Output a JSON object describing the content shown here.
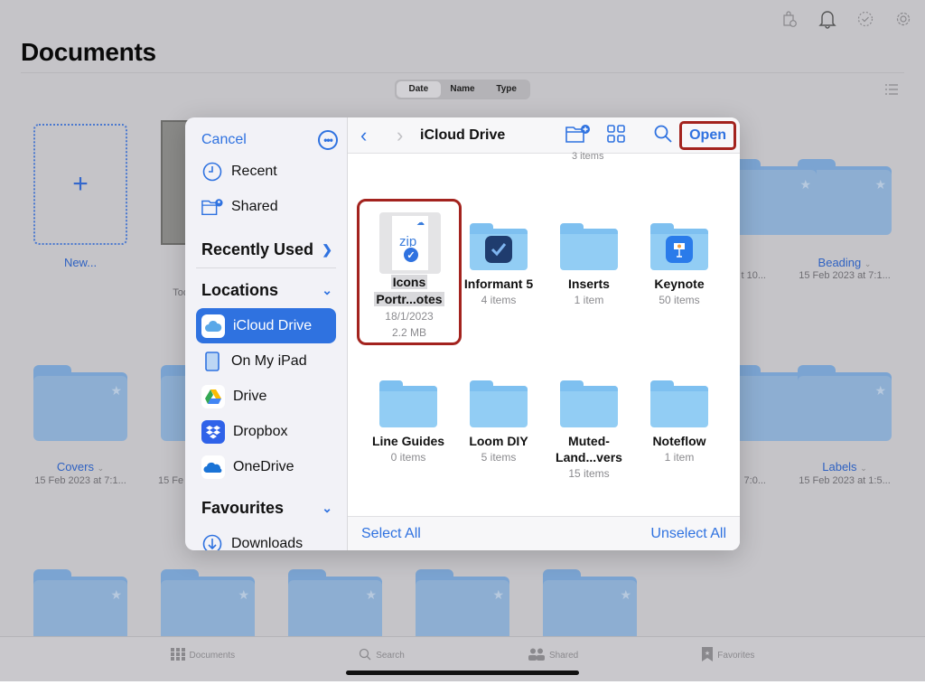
{
  "background_app": {
    "title": "Documents",
    "top_icons": [
      "shopping-bag-clock-icon",
      "bell-icon",
      "checkmark-circle-icon",
      "gear-icon"
    ],
    "sort_options": [
      {
        "label": "Date",
        "active": true
      },
      {
        "label": "Name",
        "active": false
      },
      {
        "label": "Type",
        "active": false
      }
    ],
    "new_tile_label": "New...",
    "visible_items": [
      {
        "name": "Beading",
        "date": "15 Feb 2023 at 7:1..."
      },
      {
        "name": "Covers",
        "date": "15 Feb 2023 at 7:1..."
      },
      {
        "name": "Labels",
        "date": "15 Feb 2023 at 1:5..."
      }
    ],
    "partial_subtexts": {
      "doc_sub": "Tod",
      "row1_right": "t 10...",
      "row2_left": "15 Fe",
      "row2_right": "7:0..."
    },
    "tab_bar": [
      {
        "label": "Documents",
        "icon": "grid-icon"
      },
      {
        "label": "Search",
        "icon": "search-icon"
      },
      {
        "label": "Shared",
        "icon": "people-icon"
      },
      {
        "label": "Favorites",
        "icon": "bookmark-star-icon"
      }
    ]
  },
  "picker": {
    "cancel_label": "Cancel",
    "sidebar": {
      "top_items": [
        {
          "label": "Recent",
          "icon": "clock-icon"
        },
        {
          "label": "Shared",
          "icon": "shared-folder-icon"
        }
      ],
      "recently_used": "Recently Used",
      "locations_header": "Locations",
      "locations": [
        {
          "label": "iCloud Drive",
          "icon": "icloud-icon",
          "selected": true
        },
        {
          "label": "On My iPad",
          "icon": "ipad-icon",
          "selected": false
        },
        {
          "label": "Drive",
          "icon": "google-drive-icon",
          "selected": false
        },
        {
          "label": "Dropbox",
          "icon": "dropbox-icon",
          "selected": false
        },
        {
          "label": "OneDrive",
          "icon": "onedrive-icon",
          "selected": false
        }
      ],
      "favourites_header": "Favourites",
      "favourites": [
        {
          "label": "Downloads",
          "icon": "download-circle-icon"
        }
      ]
    },
    "toolbar": {
      "title": "iCloud Drive",
      "open_label": "Open"
    },
    "partial_top_subtitle": "3 items",
    "items": [
      {
        "name_line1": "Icons",
        "name_line2": "Portr...otes",
        "sub1": "18/1/2023",
        "sub2": "2.2 MB",
        "type": "zip",
        "selected": true
      },
      {
        "name": "Informant 5",
        "sub": "4 items",
        "type": "folder",
        "badge": "informant-app-icon"
      },
      {
        "name": "Inserts",
        "sub": "1 item",
        "type": "folder"
      },
      {
        "name": "Keynote",
        "sub": "50 items",
        "type": "folder",
        "badge": "keynote-app-icon"
      },
      {
        "name": "Line Guides",
        "sub": "0 items",
        "type": "folder"
      },
      {
        "name": "Loom DIY",
        "sub": "5 items",
        "type": "folder"
      },
      {
        "name_line1": "Muted-",
        "name_line2": "Land...vers",
        "sub": "15 items",
        "type": "folder"
      },
      {
        "name": "Noteflow",
        "sub": "1 item",
        "type": "folder"
      }
    ],
    "zip_label": "zip",
    "select_all_label": "Select All",
    "unselect_all_label": "Unselect All"
  },
  "colors": {
    "accent": "#2f72e0",
    "highlight_border": "#a3231e",
    "folder": "#92cdf4"
  }
}
